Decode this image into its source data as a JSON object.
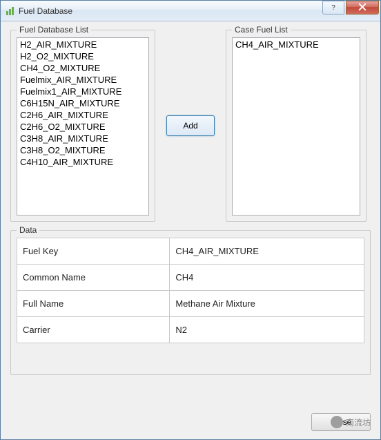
{
  "window": {
    "title": "Fuel Database",
    "help_icon_name": "help-icon",
    "close_icon_name": "close-icon"
  },
  "fuel_db": {
    "label": "Fuel Database List",
    "items": [
      "H2_AIR_MIXTURE",
      "H2_O2_MIXTURE",
      "CH4_O2_MIXTURE",
      "Fuelmix_AIR_MIXTURE",
      "Fuelmix1_AIR_MIXTURE",
      "C6H15N_AIR_MIXTURE",
      "C2H6_AIR_MIXTURE",
      "C2H6_O2_MIXTURE",
      "C3H8_AIR_MIXTURE",
      "C3H8_O2_MIXTURE",
      "C4H10_AIR_MIXTURE"
    ]
  },
  "add_button": {
    "label": "Add"
  },
  "case_fuel": {
    "label": "Case Fuel List",
    "items": [
      "CH4_AIR_MIXTURE"
    ]
  },
  "data": {
    "label": "Data",
    "rows": [
      {
        "key": "Fuel Key",
        "value": "CH4_AIR_MIXTURE"
      },
      {
        "key": "Common Name",
        "value": "CH4"
      },
      {
        "key": "Full Name",
        "value": "Methane Air Mixture"
      },
      {
        "key": "Carrier",
        "value": "N2"
      }
    ]
  },
  "bottom": {
    "close_label": "Close"
  },
  "watermark": {
    "text": "南流坊"
  }
}
